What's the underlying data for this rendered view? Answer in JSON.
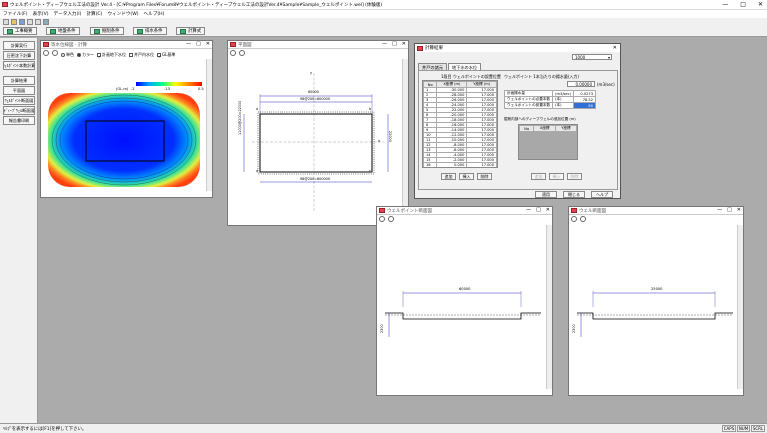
{
  "app": {
    "title": "ウェルポイント・ディープウェル工法の設計 Ver.4 - [C:¥Program Files¥Forum8¥ウェルポイント・ディープウェル工法の設計Ver.4¥Sample¥Sample_ウェルポイント.wel] (体験版)",
    "minimize": "—",
    "maximize": "□",
    "close": "✕"
  },
  "menu": [
    "ファイル(F)",
    "表示(V)",
    "データ入力(I)",
    "計算(C)",
    "ウィンドウ(W)",
    "ヘルプ(H)"
  ],
  "toolbar2": [
    "工事概要",
    "地盤条件",
    "掘削条件",
    "排水条件",
    "計算式"
  ],
  "sidebar": [
    "計算実行",
    "圧密沈下計算",
    "ｳｪﾙﾎﾟｲﾝﾄ本数計算",
    "計算結果",
    "平面図",
    "ｳｪﾙﾎﾟｲﾝﾄ断面図",
    "ﾃﾞｨｰﾌﾟｳｪﾙ断面図",
    "報告書印刷"
  ],
  "status": {
    "message": "ﾍﾙﾌﾟを表示するには[F1]を押して下さい。",
    "caps": "CAPS",
    "num": "NUM",
    "scrl": "SCRL"
  },
  "win_contour": {
    "title": "等水位線図 - 計算",
    "opt_mono": "単色",
    "opt_color": "カラー",
    "opt_design_wl": "計画地下水位",
    "opt_well_wl": "井戸内水位",
    "opt_gl": "GL基準",
    "legend_label": "(GL.m)",
    "legend_min": "-2",
    "legend_mid": "-13",
    "legend_max": "0.5"
  },
  "win_plan": {
    "title": "平面図",
    "dim_top": "60000",
    "dim_bottom_top": "98@200=600000",
    "dim_bottom": "98@200=600000",
    "dim_left": "11000@200=22000",
    "dim_right": "22000",
    "axis_x": "x",
    "axis_y": "y",
    "label_a": "a",
    "label_b": "b",
    "label_c": "c",
    "label_d": "d"
  },
  "dialog": {
    "title": "計算結果",
    "combo": "1000",
    "tab_well": "井戸の諸元",
    "tab_drain": "地下水の水位",
    "section_title": "1段目 ウェルポイントの設置位置",
    "col_no": "No",
    "col_x": "X座標 (m)",
    "col_y": "Y座標 (m)",
    "rows": [
      [
        "1",
        "-30.000",
        "17.000"
      ],
      [
        "2",
        "-28.000",
        "17.000"
      ],
      [
        "3",
        "-26.000",
        "17.000"
      ],
      [
        "4",
        "-24.000",
        "17.000"
      ],
      [
        "5",
        "-22.000",
        "17.000"
      ],
      [
        "6",
        "-20.000",
        "17.000"
      ],
      [
        "7",
        "-18.000",
        "17.000"
      ],
      [
        "8",
        "-16.000",
        "17.000"
      ],
      [
        "9",
        "-14.000",
        "17.000"
      ],
      [
        "10",
        "-12.000",
        "17.000"
      ],
      [
        "11",
        "-10.000",
        "17.000"
      ],
      [
        "12",
        "-8.000",
        "17.000"
      ],
      [
        "13",
        "-6.000",
        "17.000"
      ],
      [
        "14",
        "-4.000",
        "17.000"
      ],
      [
        "15",
        "-2.000",
        "17.000"
      ],
      [
        "16",
        "0.000",
        "17.000"
      ]
    ],
    "btn_add": "追加",
    "btn_insert": "挿入",
    "btn_delete": "削除",
    "wp_label": "ウェルポイント 1本当たりの揚水量(入力)",
    "wp_value": "0.00000",
    "wp_unit": "(m3/sec)",
    "res_rows": [
      [
        "計画揚水量",
        "(m3/sec)",
        "0.0273"
      ],
      [
        "ウェルポイントの必要本数",
        "(本)",
        "78.52"
      ],
      [
        "ウェルポイントの設置本数",
        "(本)",
        "80"
      ]
    ],
    "deep_title": "掘削内部へのディープウェルの追加位置 (m)",
    "deep_col_no": "No",
    "deep_col_x": "X座標",
    "deep_col_y": "Y座標",
    "btn_add2": "追加",
    "btn_insert2": "挿入",
    "btn_delete2": "削除",
    "btn_apply": "適用",
    "btn_close": "閉じる",
    "btn_help": "ヘルプ"
  },
  "win_wp_sec": {
    "title": "ウェルポイント断面図",
    "dim_width": "60000",
    "dim_depth": "2300"
  },
  "win_dw_sec": {
    "title": "ウェル断面図",
    "dim_width": "25000",
    "dim_depth": "2300"
  }
}
